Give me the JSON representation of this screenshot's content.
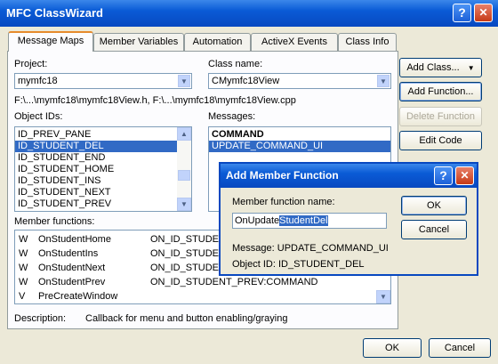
{
  "window": {
    "title": "MFC ClassWizard",
    "help_label": "?",
    "close_label": "✕"
  },
  "tabs": [
    {
      "label": "Message Maps"
    },
    {
      "label": "Member Variables"
    },
    {
      "label": "Automation"
    },
    {
      "label": "ActiveX Events"
    },
    {
      "label": "Class Info"
    }
  ],
  "project": {
    "label": "Project:",
    "value": "mymfc18"
  },
  "classname": {
    "label": "Class name:",
    "value": "CMymfc18View"
  },
  "file_path": "F:\\...\\mymfc18\\mymfc18View.h, F:\\...\\mymfc18\\mymfc18View.cpp",
  "object_ids": {
    "label": "Object IDs:",
    "items": [
      "ID_PREV_PANE",
      "ID_STUDENT_DEL",
      "ID_STUDENT_END",
      "ID_STUDENT_HOME",
      "ID_STUDENT_INS",
      "ID_STUDENT_NEXT",
      "ID_STUDENT_PREV"
    ],
    "selected": "ID_STUDENT_DEL"
  },
  "messages": {
    "label": "Messages:",
    "items": [
      "COMMAND",
      "UPDATE_COMMAND_UI"
    ],
    "selected": "UPDATE_COMMAND_UI"
  },
  "side_buttons": {
    "add_class": "Add Class...",
    "add_function": "Add Function...",
    "delete_function": "Delete Function",
    "edit_code": "Edit Code"
  },
  "member_functions": {
    "label": "Member functions:",
    "rows": [
      {
        "type": "W",
        "name": "OnStudentHome",
        "map": "ON_ID_STUDEN"
      },
      {
        "type": "W",
        "name": "OnStudentIns",
        "map": "ON_ID_STUDEN"
      },
      {
        "type": "W",
        "name": "OnStudentNext",
        "map": "ON_ID_STUDEN"
      },
      {
        "type": "W",
        "name": "OnStudentPrev",
        "map": "ON_ID_STUDENT_PREV:COMMAND"
      },
      {
        "type": "V",
        "name": "PreCreateWindow",
        "map": ""
      }
    ]
  },
  "description": {
    "label": "Description:",
    "value": "Callback for menu and button enabling/graying"
  },
  "footer": {
    "ok": "OK",
    "cancel": "Cancel"
  },
  "dialog": {
    "title": "Add Member Function",
    "help_label": "?",
    "close_label": "✕",
    "name_label": "Member function name:",
    "name_prefix": "OnUpdate",
    "name_selected": "StudentDel",
    "message": "Message: UPDATE_COMMAND_UI",
    "object_id": "Object ID: ID_STUDENT_DEL",
    "ok": "OK",
    "cancel": "Cancel"
  }
}
